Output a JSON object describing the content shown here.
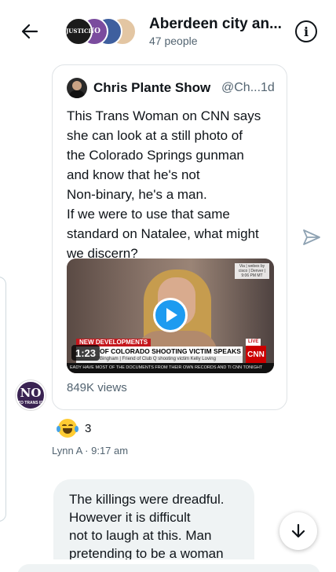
{
  "header": {
    "title": "Aberdeen city an...",
    "subtitle": "47 people",
    "avatar_texts": [
      "JUSTICE",
      "NO",
      "",
      ""
    ]
  },
  "tweet": {
    "author_name": "Chris Plante Show",
    "author_handle_time": "@Ch...1d",
    "text_lines": [
      "This Trans Woman on CNN says",
      "she can look at a still photo of",
      "the Colorado Springs gunman",
      "and know that he's not",
      "Non-binary, he's a man.",
      "If we were to use that same",
      "standard on Natalee, what might",
      "we discern?"
    ],
    "video": {
      "duration": "1:23",
      "chyron_top": "NEW DEVELOPMENTS",
      "chyron_headline": "OF COLORADO SHOOTING VICTIM SPEAKS OUT",
      "chyron_sub": "Bingham | Friend of Club Q shooting victim Kelly Loving",
      "ticker": "EADY HAVE MOST OF THE DOCUMENTS FROM THEIR OWN RECORDS AND TI CNN TONIGHT",
      "live": "LIVE",
      "network": "CNN",
      "bug_text": "Via | webex by cisco | Denver | 9:06 PM MT"
    },
    "views": "849K views"
  },
  "sender_avatar": {
    "text": "NO",
    "subtext": "TO TRANS ID"
  },
  "reaction": {
    "emoji": "laughing-crying-emoji",
    "count": "3"
  },
  "message_meta": "Lynn A · 9:17 am",
  "reply": {
    "lines": [
      "The killings were dreadful.",
      "However it is difficult",
      "not to laugh at this.  Man",
      "pretending to be a woman"
    ]
  },
  "colors": {
    "accent": "#1d9bf0",
    "text": "#0f1419",
    "muted": "#536471",
    "bubble": "#eff3f4",
    "cnn_red": "#cc0000"
  }
}
